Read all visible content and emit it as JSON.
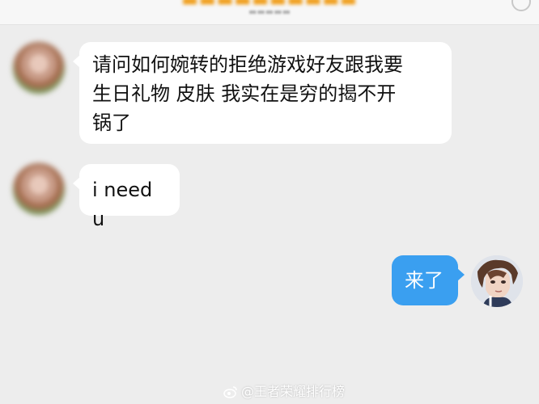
{
  "messages": [
    {
      "side": "left",
      "lines": [
        "请问如何婉转的拒绝游戏好友跟我要",
        "生日礼物 皮肤 我实在是穷的揭不开",
        "锅了"
      ]
    },
    {
      "side": "left",
      "text": "i need u"
    },
    {
      "side": "right",
      "text": "来了"
    }
  ],
  "watermark": "@王者荣耀排行榜",
  "colors": {
    "background": "#ededed",
    "incoming_bubble": "#ffffff",
    "outgoing_bubble": "#3a9ff0",
    "header_text": "#f0a020"
  },
  "icons": [
    "weibo-logo-icon",
    "avatar-contact",
    "avatar-self"
  ]
}
